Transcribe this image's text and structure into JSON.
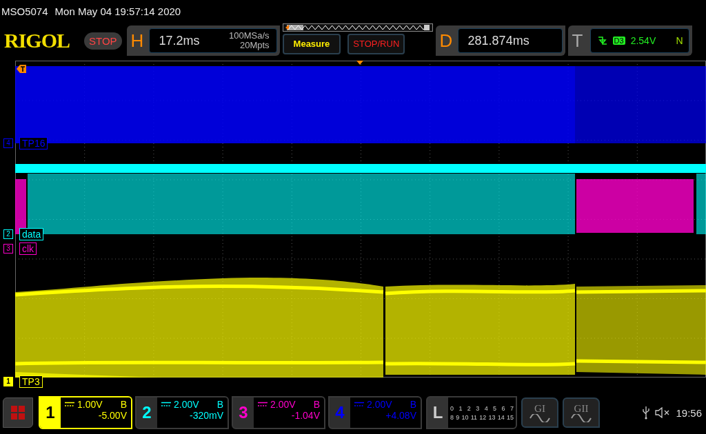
{
  "status_line": {
    "model": "MSO5074",
    "datetime": "Mon May 04 19:57:14 2020"
  },
  "header": {
    "logo": "RIGOL",
    "run_state": "STOP",
    "horizontal": {
      "letter": "H",
      "timebase": "17.2ms",
      "sample_rate": "100MSa/s",
      "memory_depth": "20Mpts"
    },
    "measure_button": "Measure",
    "stop_run_button": "STOP/RUN",
    "delay": {
      "letter": "D",
      "value": "281.874ms"
    },
    "trigger": {
      "letter": "T",
      "source": "D3",
      "level": "2.54V",
      "mode": "N"
    }
  },
  "trace_labels": [
    {
      "marker": "4",
      "label": "TP16",
      "color": "#0000ff",
      "selected": false
    },
    {
      "marker": "2",
      "label": "data",
      "color": "#00ffff",
      "selected": false
    },
    {
      "marker": "3",
      "label": "clk",
      "color": "#ff00cc",
      "selected": false
    },
    {
      "marker": "1",
      "label": "TP3",
      "color": "#ffff00",
      "selected": true
    }
  ],
  "channels": [
    {
      "number": "1",
      "scale": "1.00V",
      "bandwidth": "B",
      "offset": "-5.00V",
      "color": "#ffff00",
      "selected": true
    },
    {
      "number": "2",
      "scale": "2.00V",
      "bandwidth": "B",
      "offset": "-320mV",
      "color": "#00ffff",
      "selected": false
    },
    {
      "number": "3",
      "scale": "2.00V",
      "bandwidth": "B",
      "offset": "-1.04V",
      "color": "#ff00cc",
      "selected": false
    },
    {
      "number": "4",
      "scale": "2.00V",
      "bandwidth": "B",
      "offset": "+4.08V",
      "color": "#0000ff",
      "selected": false
    }
  ],
  "logic": {
    "letter": "L",
    "bits_row_1": [
      "0",
      "1",
      "2",
      "3",
      "4",
      "5",
      "6",
      "7"
    ],
    "bits_row_2": [
      "8",
      "9",
      "10",
      "11",
      "12",
      "13",
      "14",
      "15"
    ]
  },
  "generators": [
    {
      "label": "GI"
    },
    {
      "label": "GII"
    }
  ],
  "system_tray": {
    "time": "19:56"
  }
}
